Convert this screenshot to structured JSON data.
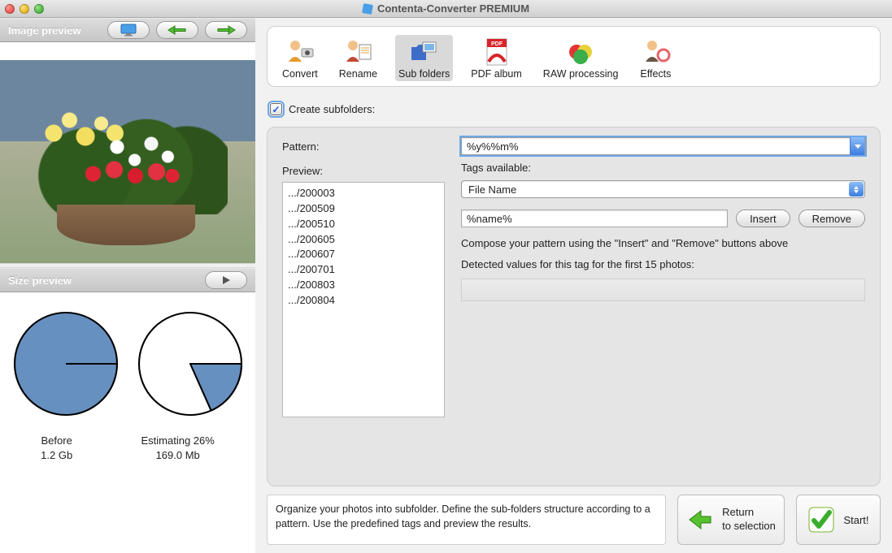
{
  "window": {
    "title": "Contenta-Converter PREMIUM"
  },
  "left": {
    "imagePreviewTitle": "Image preview",
    "sizePreviewTitle": "Size preview",
    "before": {
      "label": "Before",
      "value": "1.2 Gb"
    },
    "after": {
      "label": "Estimating 26%",
      "value": "169.0 Mb"
    }
  },
  "tabs": {
    "convert": "Convert",
    "rename": "Rename",
    "subfolders": "Sub folders",
    "pdfalbum": "PDF album",
    "rawprocessing": "RAW processing",
    "effects": "Effects"
  },
  "form": {
    "createSubfolders": "Create subfolders:",
    "patternLabel": "Pattern:",
    "patternValue": "%y%%m%",
    "previewLabel": "Preview:",
    "previewItems": [
      ".../200003",
      ".../200509",
      ".../200510",
      ".../200605",
      ".../200607",
      ".../200701",
      ".../200803",
      ".../200804"
    ],
    "tagsAvailable": "Tags available:",
    "tagsSelectValue": "File Name",
    "tagToken": "%name%",
    "insert": "Insert",
    "remove": "Remove",
    "compose": "Compose your pattern using the \"Insert\" and \"Remove\" buttons above",
    "detected": "Detected values for this tag for the first 15 photos:"
  },
  "footer": {
    "info": "Organize your photos into subfolder. Define the sub-folders structure according to a pattern. Use the predefined tags and preview the results.",
    "returnLine1": "Return",
    "returnLine2": "to selection",
    "start": "Start!"
  },
  "chart_data": {
    "type": "pie",
    "series": [
      {
        "name": "Before",
        "values": [
          100
        ],
        "label": "1.2 Gb"
      },
      {
        "name": "Estimating 26%",
        "values": [
          26,
          74
        ],
        "label": "169.0 Mb"
      }
    ]
  }
}
